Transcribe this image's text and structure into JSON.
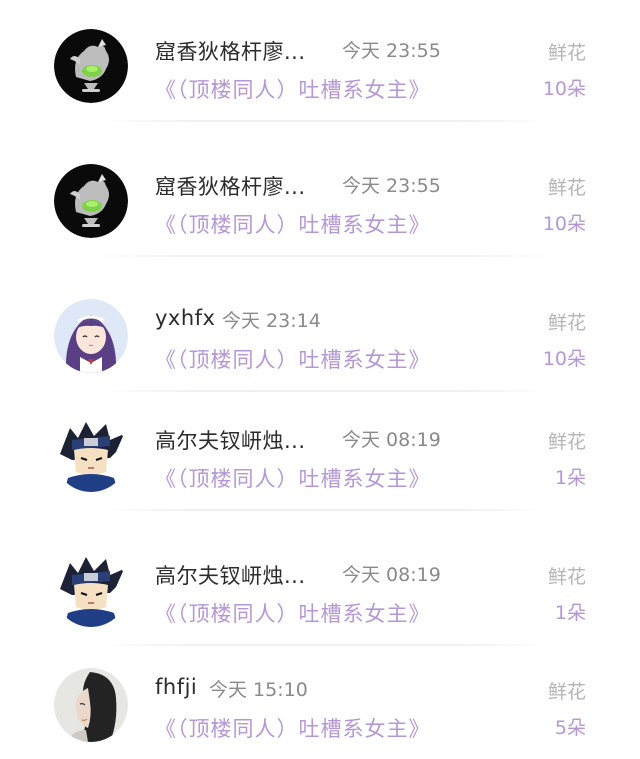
{
  "list": {
    "items": [
      {
        "user": "窟香狄格杆廖...",
        "time": "今天 23:55",
        "book": "《（顶楼同人）吐槽系女主》",
        "gift_label": "鲜花",
        "gift_count": "10朵",
        "avatar": "rooster-avatar-icon"
      },
      {
        "user": "窟香狄格杆廖...",
        "time": "今天 23:55",
        "book": "《（顶楼同人）吐槽系女主》",
        "gift_label": "鲜花",
        "gift_count": "10朵",
        "avatar": "rooster-avatar-icon"
      },
      {
        "user": "yxhfx",
        "time": "今天 23:14",
        "book": "《（顶楼同人）吐槽系女主》",
        "gift_label": "鲜花",
        "gift_count": "10朵",
        "avatar": "anime-girl-avatar-icon"
      },
      {
        "user": "高尔夫钗岍烛...",
        "time": "今天 08:19",
        "book": "《（顶楼同人）吐槽系女主》",
        "gift_label": "鲜花",
        "gift_count": "1朵",
        "avatar": "ninja-avatar-icon"
      },
      {
        "user": "高尔夫钗岍烛...",
        "time": "今天 08:19",
        "book": "《（顶楼同人）吐槽系女主》",
        "gift_label": "鲜花",
        "gift_count": "1朵",
        "avatar": "ninja-avatar-icon"
      },
      {
        "user": "fhfji",
        "time": "今天 15:10",
        "book": "《（顶楼同人）吐槽系女主》",
        "gift_label": "鲜花",
        "gift_count": "5朵",
        "avatar": "woman-photo-avatar-icon"
      }
    ]
  },
  "colors": {
    "accent_purple": "#b597d6",
    "name_text": "#2b2b2b",
    "time_text": "#8a8a8a",
    "gift_label_text": "#b5b5b5"
  }
}
